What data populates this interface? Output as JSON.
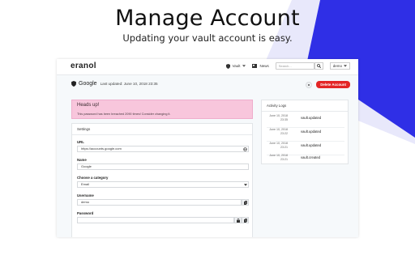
{
  "hero": {
    "title": "Manage Account",
    "subtitle": "Updating your vault account is easy."
  },
  "colors": {
    "accent_blue": "#2f2fe6",
    "light_lavender": "#e8e8fb",
    "alert_bg": "#f8c6dc",
    "delete_red": "#e32626"
  },
  "navbar": {
    "brand": "eranol",
    "vault_label": "Vault",
    "news_label": "News",
    "search_placeholder": "Search...",
    "user_label": "demo"
  },
  "header": {
    "site_name": "Google",
    "last_updated": "Last updated: June 10, 2018 23:35",
    "delete_label": "Delete Account"
  },
  "alert": {
    "title": "Heads up!",
    "message": "This password has been breached 2090 times! Consider changing it."
  },
  "settings": {
    "title": "Settings",
    "fields": {
      "url_label": "URL",
      "url_value": "https://accounts.google.com",
      "name_label": "Name",
      "name_value": "Google",
      "category_label": "Choose a category",
      "category_value": "Email",
      "username_label": "Username",
      "username_value": "demo",
      "password_label": "Password"
    }
  },
  "activity": {
    "title": "Activity Logs",
    "logs": [
      {
        "date": "June 10, 2018",
        "time": "23:35",
        "action": "vault.updated"
      },
      {
        "date": "June 10, 2018",
        "time": "23:22",
        "action": "vault.updated"
      },
      {
        "date": "June 10, 2018",
        "time": "23:21",
        "action": "vault.updated"
      },
      {
        "date": "June 10, 2018",
        "time": "23:21",
        "action": "vault.created"
      }
    ]
  },
  "icons": [
    "shield-icon",
    "newspaper-icon",
    "search-icon",
    "chevron-down-icon",
    "globe-icon",
    "copy-icon",
    "lock-icon",
    "share-icon"
  ]
}
